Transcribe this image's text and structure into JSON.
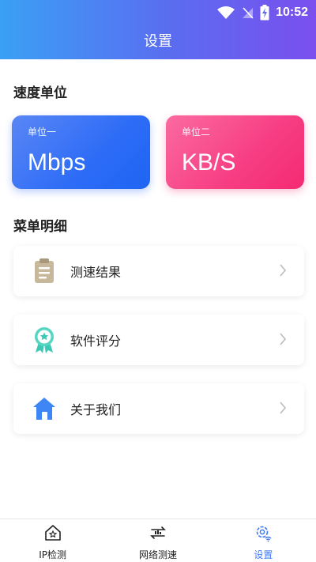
{
  "status": {
    "time": "10:52"
  },
  "header": {
    "title": "设置"
  },
  "speed_section": {
    "title": "速度单位",
    "cards": [
      {
        "sub": "单位一",
        "value": "Mbps"
      },
      {
        "sub": "单位二",
        "value": "KB/S"
      }
    ]
  },
  "menu_section": {
    "title": "菜单明细",
    "items": [
      {
        "label": "测速结果",
        "icon": "clipboard-icon"
      },
      {
        "label": "软件评分",
        "icon": "award-badge-icon"
      },
      {
        "label": "关于我们",
        "icon": "home-icon"
      }
    ]
  },
  "tabs": [
    {
      "label": "IP检测",
      "icon": "house-star-icon",
      "active": false
    },
    {
      "label": "网络测速",
      "icon": "speed-test-icon",
      "active": false
    },
    {
      "label": "设置",
      "icon": "gear-wifi-icon",
      "active": true
    }
  ],
  "colors": {
    "accent": "#3f7af5",
    "card_blue": "#2d6cf6",
    "card_pink": "#f73e83"
  }
}
